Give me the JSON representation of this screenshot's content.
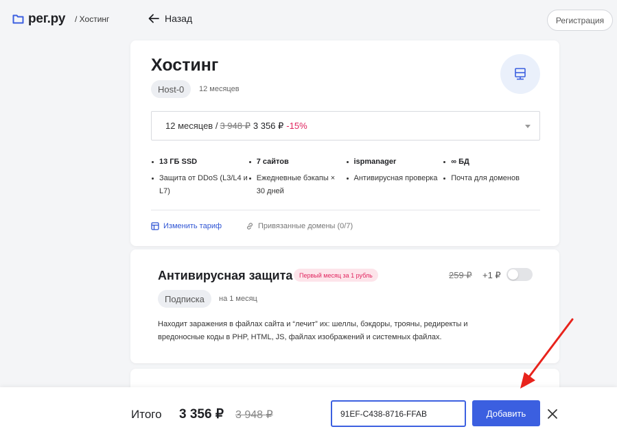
{
  "header": {
    "logo_text": "рег.ру",
    "breadcrumb": "/ Хостинг",
    "back_label": "Назад",
    "register_label": "Регистрация"
  },
  "hosting": {
    "title": "Хостинг",
    "plan": "Host-0",
    "period": "12 месяцев",
    "select": {
      "period": "12 месяцев /",
      "old_price": "3 948 ₽",
      "price": "3 356 ₽",
      "discount": "-15%"
    },
    "features": [
      {
        "title": "13 ГБ SSD",
        "desc": "Защита от DDoS (L3/L4 и L7)"
      },
      {
        "title": "7 сайтов",
        "desc": "Ежедневные бэкапы × 30 дней"
      },
      {
        "title": "ispmanager",
        "desc": "Антивирусная проверка"
      },
      {
        "title": "∞ БД",
        "desc": "Почта для доменов"
      }
    ],
    "change_plan_label": "Изменить тариф",
    "domains_label": "Привязанные домены (0/7)"
  },
  "antivirus": {
    "title": "Антивирусная защита",
    "promo_badge": "Первый месяц за 1 рубль",
    "old_price": "259 ₽",
    "new_price": "+1 ₽",
    "toggle_on": false,
    "subscription": "Подписка",
    "period": "на 1 месяц",
    "description": "Находит заражения в файлах сайта и “лечит” их: шеллы, бэкдоры, трояны, редиректы и вредоносные коды в PHP, HTML, JS, файлах изображений и системных файлах."
  },
  "footer": {
    "total_label": "Итого",
    "total_price": "3 356 ₽",
    "total_old_price": "3 948 ₽",
    "promo_code_value": "91EF-C438-8716-FFAB",
    "add_label": "Добавить"
  },
  "colors": {
    "accent": "#3b5fe0",
    "discount": "#e0245e",
    "annotation_arrow": "#e8231c"
  }
}
